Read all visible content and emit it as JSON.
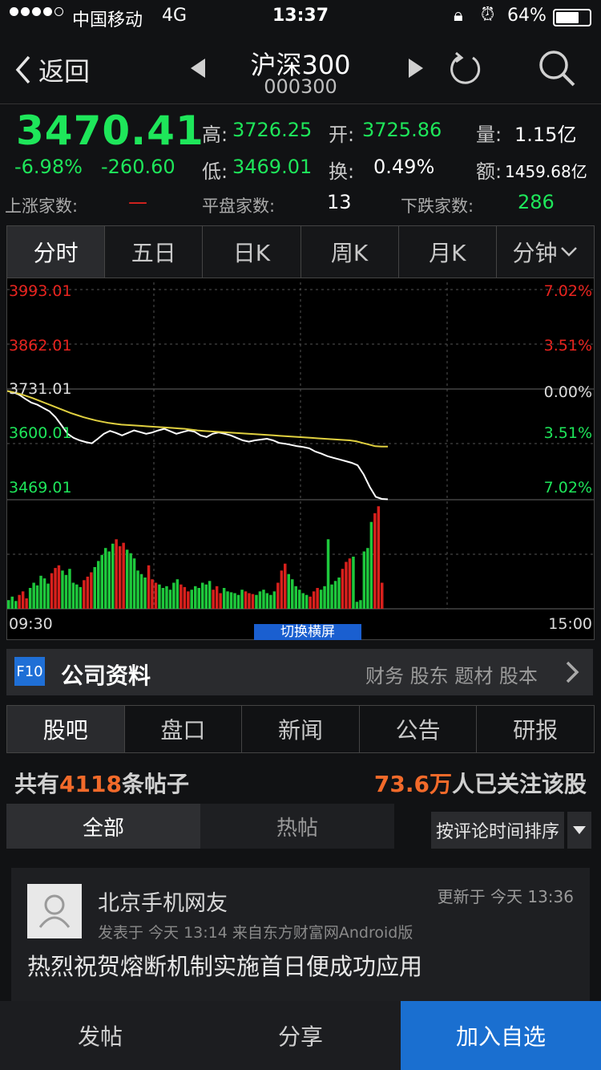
{
  "status": {
    "carrier": "中国移动",
    "network": "4G",
    "time": "13:37",
    "battery": "64%"
  },
  "header": {
    "back_label": "返回",
    "title": "沪深300",
    "code": "000300"
  },
  "quote": {
    "price": "3470.41",
    "change_pct": "-6.98%",
    "change_val": "-260.60",
    "high_label": "高:",
    "high": "3726.25",
    "open_label": "开:",
    "open": "3725.86",
    "vol_label": "量:",
    "vol": "1.15亿",
    "low_label": "低:",
    "low": "3469.01",
    "turn_label": "换:",
    "turn": "0.49%",
    "amt_label": "额:",
    "amt": "1459.68亿",
    "up_label": "上涨家数:",
    "up_val": "—",
    "flat_label": "平盘家数:",
    "flat_val": "13",
    "down_label": "下跌家数:",
    "down_val": "286"
  },
  "chart_tabs": [
    "分时",
    "五日",
    "日K",
    "周K",
    "月K",
    "分钟"
  ],
  "chart_data": {
    "type": "line",
    "y_left_labels": [
      "3993.01",
      "3862.01",
      "3731.01",
      "3600.01",
      "3469.01"
    ],
    "y_right_labels": [
      "7.02%",
      "3.51%",
      "0.00%",
      "3.51%",
      "7.02%"
    ],
    "x_start": "09:30",
    "x_end": "15:00",
    "ylim": [
      3469.01,
      3993.01
    ],
    "series": [
      {
        "color": "#ffffff",
        "values": [
          3731,
          3728,
          3722,
          3712,
          3703,
          3698,
          3690,
          3682,
          3668,
          3648,
          3628,
          3618,
          3612,
          3608,
          3605,
          3616,
          3628,
          3635,
          3630,
          3624,
          3630,
          3636,
          3632,
          3628,
          3631,
          3636,
          3640,
          3634,
          3628,
          3632,
          3636,
          3633,
          3624,
          3620,
          3628,
          3631,
          3628,
          3624,
          3618,
          3612,
          3609,
          3612,
          3614,
          3616,
          3612,
          3606,
          3604,
          3601,
          3598,
          3596,
          3593,
          3585,
          3580,
          3574,
          3570,
          3566,
          3562,
          3558,
          3552,
          3530,
          3500,
          3476,
          3471,
          3470
        ]
      },
      {
        "color": "#e0d040",
        "values": [
          3731,
          3728,
          3724,
          3719,
          3714,
          3708,
          3702,
          3696,
          3690,
          3684,
          3678,
          3673,
          3668,
          3664,
          3660,
          3657,
          3654,
          3652,
          3650,
          3649,
          3648,
          3647,
          3646,
          3645,
          3644,
          3643,
          3642,
          3641,
          3640,
          3638,
          3636,
          3635,
          3634,
          3633,
          3632,
          3631,
          3630,
          3629,
          3628,
          3627,
          3626,
          3625,
          3624,
          3623,
          3622,
          3621,
          3620,
          3619,
          3618,
          3617,
          3616,
          3615,
          3614,
          3613,
          3612,
          3610,
          3606,
          3602,
          3598,
          3597,
          3597
        ]
      }
    ],
    "volume": [
      10,
      14,
      9,
      16,
      20,
      12,
      24,
      30,
      27,
      38,
      35,
      29,
      41,
      47,
      50,
      44,
      39,
      46,
      30,
      28,
      25,
      33,
      37,
      42,
      48,
      55,
      62,
      70,
      66,
      75,
      80,
      72,
      76,
      68,
      64,
      58,
      44,
      40,
      36,
      50,
      34,
      30,
      28,
      24,
      26,
      22,
      30,
      34,
      28,
      25,
      20,
      22,
      26,
      24,
      30,
      28,
      32,
      22,
      26,
      18,
      24,
      20,
      19,
      18,
      16,
      22,
      20,
      18,
      17,
      16,
      20,
      22,
      18,
      16,
      20,
      30,
      44,
      52,
      40,
      34,
      26,
      22,
      18,
      16,
      14,
      20,
      24,
      22,
      26,
      80,
      28,
      32,
      36,
      46,
      54,
      58,
      60,
      8,
      10,
      66,
      70,
      100,
      110,
      118,
      30,
      0
    ]
  },
  "f10": {
    "badge": "F10",
    "title": "公司资料",
    "links": "财务 股东 题材 股本"
  },
  "news_tabs": [
    "股吧",
    "盘口",
    "新闻",
    "公告",
    "研报"
  ],
  "stats": {
    "prefix": "共有",
    "count": "4118",
    "suffix": "条帖子",
    "follow_num": "73.6万",
    "follow_text": "人已关注该股"
  },
  "filter": {
    "all": "全部",
    "hot": "热帖",
    "sort": "按评论时间排序"
  },
  "post": {
    "user": "北京手机网友",
    "updated": "更新于 今天 13:36",
    "posted": "发表于 今天 13:14  来自东方财富网Android版",
    "title": "热烈祝贺熔断机制实施首日便成功应用"
  },
  "bottom": {
    "post": "发帖",
    "share": "分享",
    "add": "加入自选"
  },
  "switch_label": "切换横屏"
}
